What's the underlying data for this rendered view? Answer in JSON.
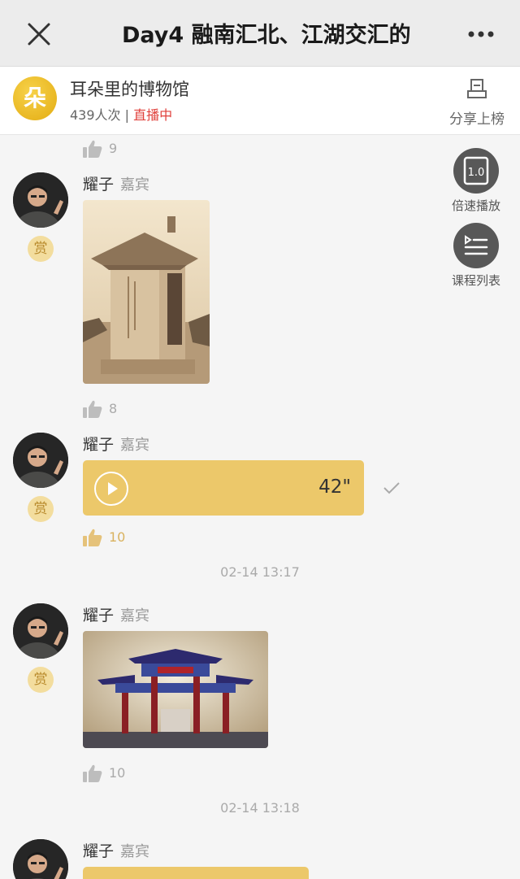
{
  "header": {
    "title": "Day4 融南汇北、江湖交汇的",
    "close_icon": "close-icon",
    "more_icon": "more-dots-icon"
  },
  "live": {
    "logo_text": "朵",
    "name": "耳朵里的博物馆",
    "views": "439人次",
    "divider": " | ",
    "status": "直播中",
    "share_label": "分享上榜"
  },
  "float_buttons": [
    {
      "label": "倍速播放",
      "icon": "speed-icon",
      "badge": "1.0"
    },
    {
      "label": "课程列表",
      "icon": "course-list-icon"
    }
  ],
  "feed": {
    "top_like": {
      "count": "9"
    },
    "messages": [
      {
        "sender": "耀子",
        "role": "嘉宾",
        "reward": "赏",
        "type": "image",
        "likes": "8"
      },
      {
        "sender": "耀子",
        "role": "嘉宾",
        "reward": "赏",
        "type": "audio",
        "duration": "42\"",
        "likes": "10",
        "liked": true
      },
      {
        "sender": "耀子",
        "role": "嘉宾",
        "reward": "赏",
        "type": "image",
        "likes": "10"
      },
      {
        "sender": "耀子",
        "role": "嘉宾",
        "type": "audio"
      }
    ],
    "timestamps": [
      "02-14 13:17",
      "02-14 13:18"
    ]
  },
  "colors": {
    "accent_gold": "#ecc86a",
    "live_status": "#e0403b",
    "reward_bg": "#f3dd9e"
  }
}
